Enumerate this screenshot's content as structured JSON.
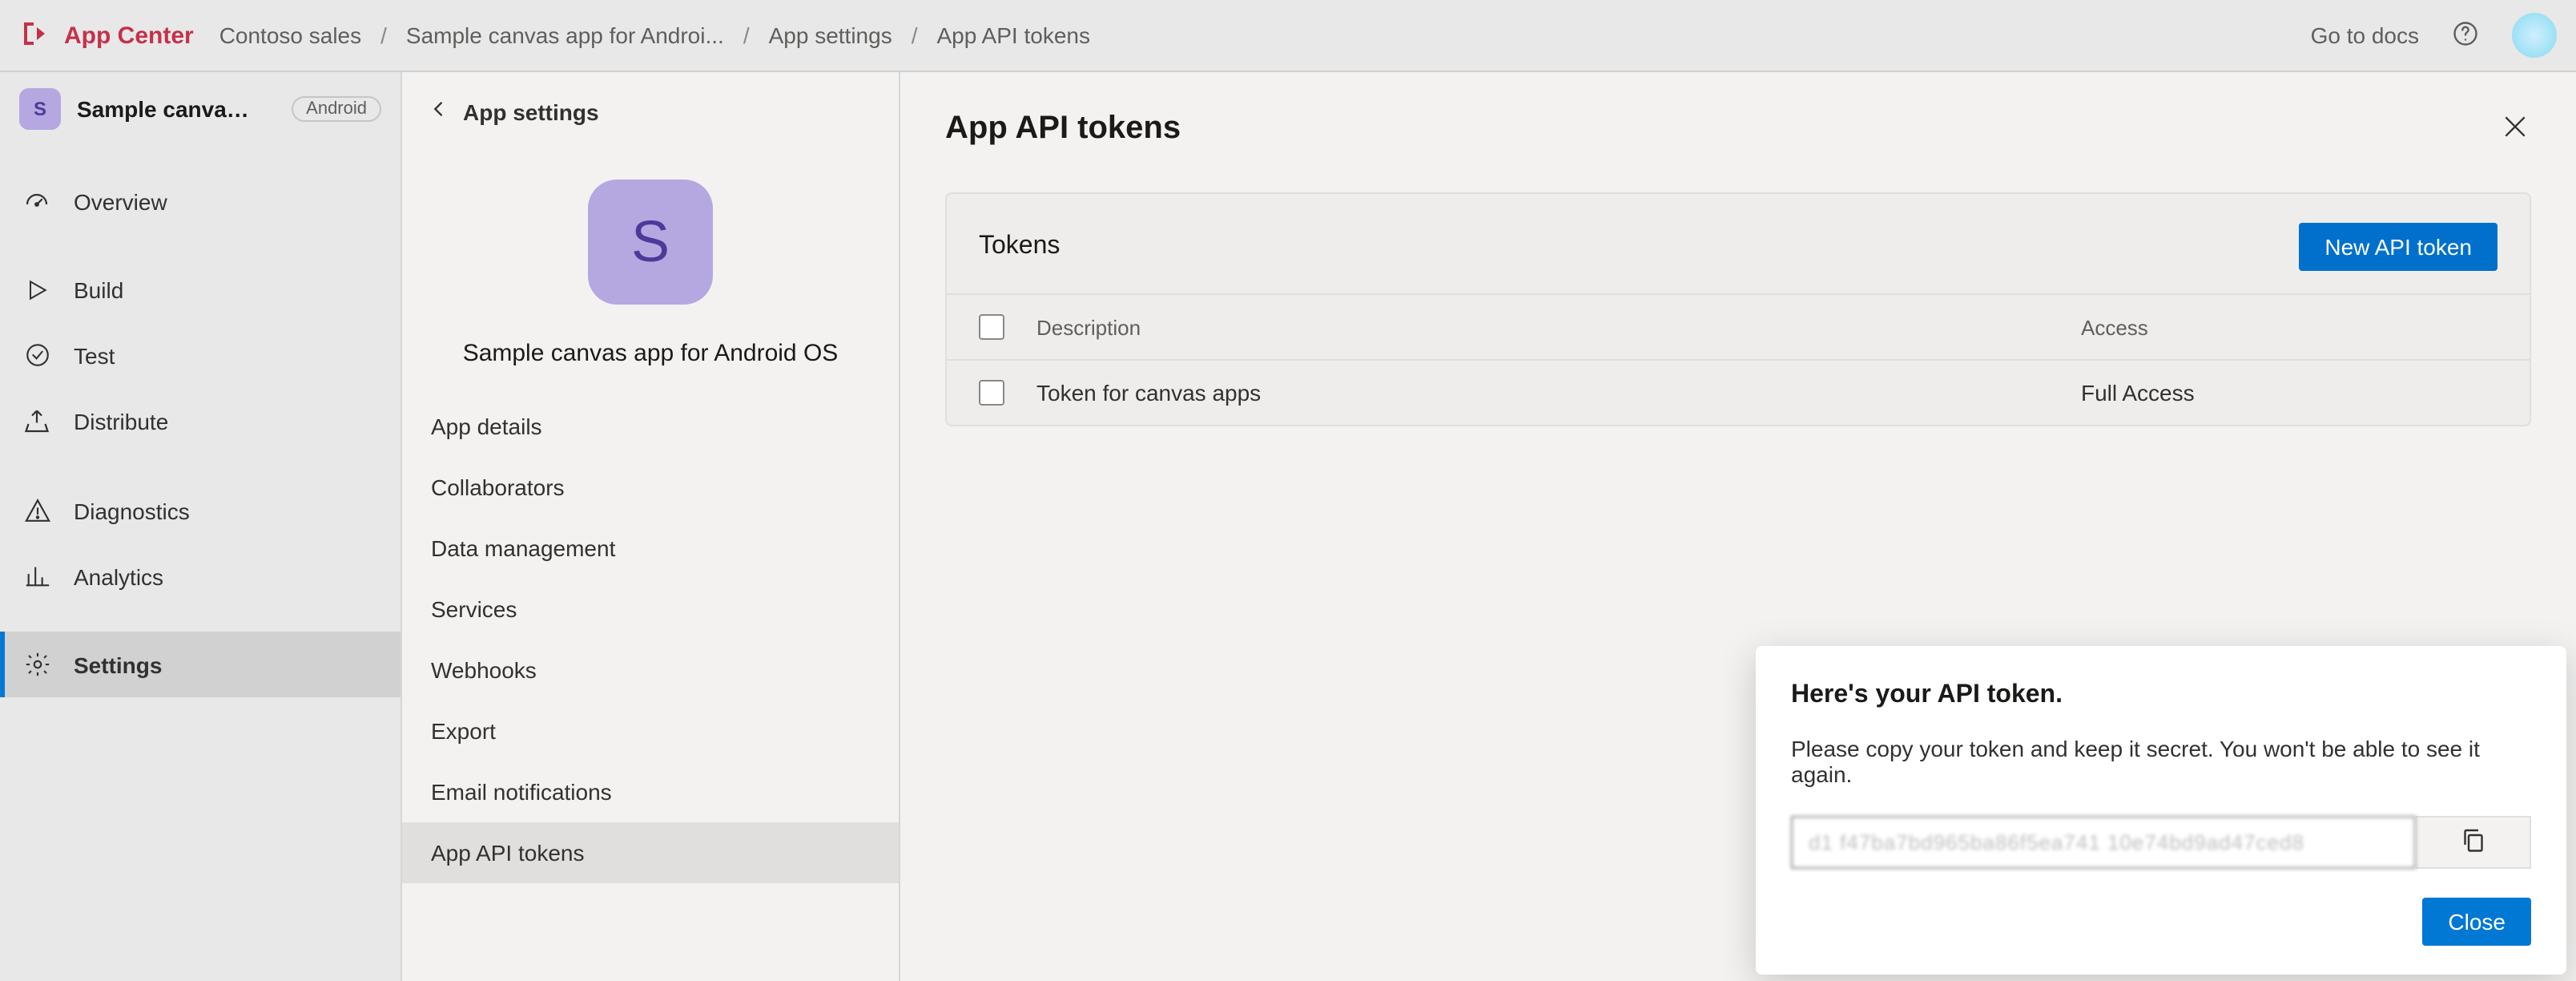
{
  "header": {
    "brand": "App Center",
    "breadcrumb": [
      "Contoso sales",
      "Sample canvas app for Androi...",
      "App settings",
      "App API tokens"
    ],
    "goto_docs": "Go to docs"
  },
  "leftnav": {
    "app_tile_letter": "S",
    "app_name": "Sample canvas ...",
    "platform_badge": "Android",
    "items": [
      {
        "label": "Overview"
      },
      {
        "label": "Build"
      },
      {
        "label": "Test"
      },
      {
        "label": "Distribute"
      },
      {
        "label": "Diagnostics"
      },
      {
        "label": "Analytics"
      },
      {
        "label": "Settings",
        "active": true
      }
    ]
  },
  "settings_col": {
    "back_label": "App settings",
    "hero_letter": "S",
    "hero_name": "Sample canvas app for Android OS",
    "items": [
      {
        "label": "App details"
      },
      {
        "label": "Collaborators"
      },
      {
        "label": "Data management"
      },
      {
        "label": "Services"
      },
      {
        "label": "Webhooks"
      },
      {
        "label": "Export"
      },
      {
        "label": "Email notifications"
      },
      {
        "label": "App API tokens",
        "active": true
      }
    ]
  },
  "main": {
    "title": "App API tokens",
    "card_title": "Tokens",
    "new_token_btn": "New API token",
    "columns": {
      "description": "Description",
      "access": "Access"
    },
    "rows": [
      {
        "description": "Token for canvas apps",
        "access": "Full Access"
      }
    ]
  },
  "modal": {
    "title": "Here's your API token.",
    "body": "Please copy your token and keep it secret. You won't be able to see it again.",
    "token_placeholder": "d1 f47ba7bd965ba86f5ea741 10e74bd9ad47ced8",
    "close_btn": "Close"
  }
}
